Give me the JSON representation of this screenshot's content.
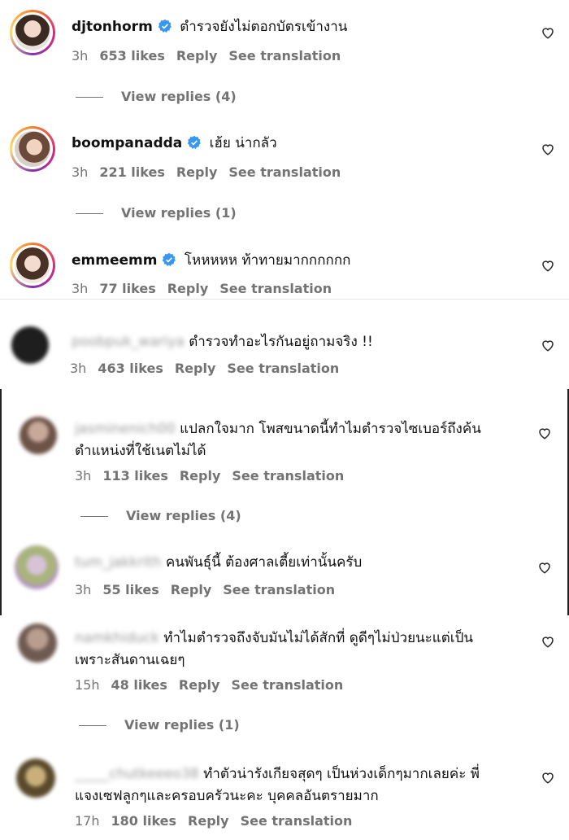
{
  "comments": [
    {
      "username": "djtonhorm",
      "verified": true,
      "text": "ตำรวจยังไม่ตอกบัตรเข้างาน",
      "time": "3h",
      "likes": "653 likes",
      "reply": "Reply",
      "translate": "See translation",
      "view_replies": "View replies (4)"
    },
    {
      "username": "boompanadda",
      "verified": true,
      "text": "เฮ้ย น่ากลัว",
      "time": "3h",
      "likes": "221 likes",
      "reply": "Reply",
      "translate": "See translation",
      "view_replies": "View replies (1)"
    },
    {
      "username": "emmeemm",
      "verified": true,
      "text": "โหหหหห ท้าทายมากกกกกก",
      "time": "3h",
      "likes": "77 likes",
      "reply": "Reply",
      "translate": "See translation"
    },
    {
      "username": "poobpuk_wariya",
      "text": "ตำรวจทำอะไรกันอยู่ถามจริง !!",
      "time": "3h",
      "likes": "463 likes",
      "reply": "Reply",
      "translate": "See translation"
    },
    {
      "username": "jasminenich00",
      "text_line1": "แปลกใจมาก โพสขนาดนี้ทำไมตำรวจไซเบอร์ถึงค้น",
      "text_line2": "ตำแหน่งที่ใช้เนตไม่ได้",
      "time": "3h",
      "likes": "113 likes",
      "reply": "Reply",
      "translate": "See translation",
      "view_replies": "View replies (4)"
    },
    {
      "username": "tum_jakkrith",
      "text": "คนพันธุ์นี้ ต้องศาลเตี้ยเท่านั้นครับ",
      "time": "3h",
      "likes": "55 likes",
      "reply": "Reply",
      "translate": "See translation"
    },
    {
      "username": "namkhiduck",
      "text_line1": "ทำไมตำรวจถึงจับมันไม่ได้สักที่ ดูดีๆไม่ป่วยนะแต่เป็น",
      "text_line2": "เพราะสันดานเฉยๆ",
      "time": "15h",
      "likes": "48 likes",
      "reply": "Reply",
      "translate": "See translation",
      "view_replies": "View replies (1)"
    },
    {
      "username": "_____chutkeeeo38",
      "text_line1": "ทำตัวน่ารังเกียจสุดๆ เป็นห่วงเด็กๆมากเลยค่ะ พี่",
      "text_line2": "แจงเซฟลูกๆและครอบครัวนะคะ บุคคลอันตรายมาก",
      "time": "17h",
      "likes": "180 likes",
      "reply": "Reply",
      "translate": "See translation"
    }
  ],
  "icons": {
    "heart": "heart-icon",
    "verified": "verified-badge-icon"
  },
  "colors": {
    "verified": "#3897f0",
    "meta": "#737373"
  }
}
